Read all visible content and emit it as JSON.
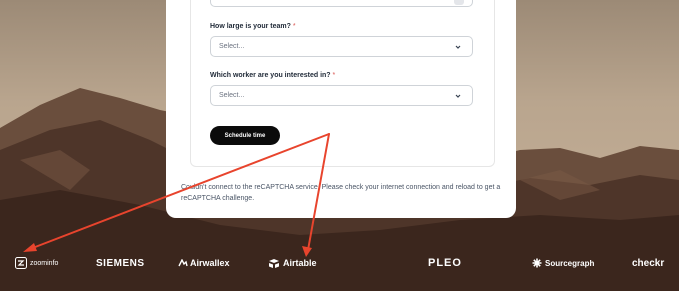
{
  "form": {
    "team_size": {
      "label": "How large is your team?",
      "required_mark": "*",
      "placeholder": "Select..."
    },
    "worker": {
      "label": "Which worker are you interested in?",
      "required_mark": "*",
      "placeholder": "Select..."
    },
    "submit_label": "Schedule time",
    "captcha_message": "Couldn't connect to the reCAPTCHA service. Please check your internet connection and reload to get a reCAPTCHA challenge."
  },
  "logos": {
    "zoominfo": "zoominfo",
    "siemens": "SIEMENS",
    "airwallex": "Airwallex",
    "airtable": "Airtable",
    "pleo": "PLEO",
    "sourcegraph": "Sourcegraph",
    "checkr": "checkr"
  },
  "colors": {
    "arrow": "#e8442d",
    "button": "#0b0b0b",
    "required": "#d9534f"
  }
}
